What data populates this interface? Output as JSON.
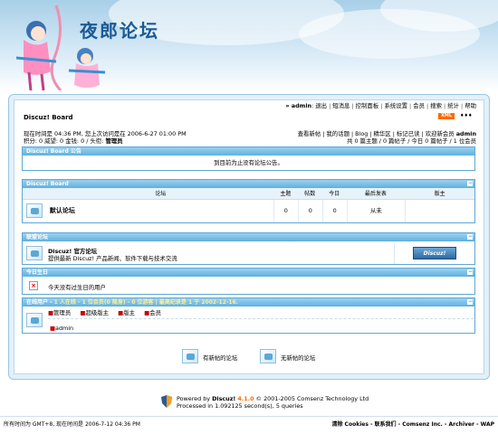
{
  "site": {
    "title": "夜郎论坛"
  },
  "topnav": {
    "user": "admin",
    "items": [
      "退出",
      "短消息",
      "控制面板",
      "系统设置",
      "会员",
      "搜索",
      "统计",
      "帮助"
    ]
  },
  "board": {
    "name": "Discuz! Board",
    "xml": "XML",
    "arrows": "♦♦♦"
  },
  "status": {
    "time_prefix": "现在时间是",
    "time": "04:36 PM",
    "last_visit_prefix": ", 您上次访问是在",
    "last_visit": "2006-6-27 01:00 PM",
    "credits": "积分: 0 威望: 0 金钱: 0 / 头衔:",
    "title": "管理员",
    "links": "查看新帖 | 我的话题 | Blog | 精华区 | 标记已读 | 欢迎新会员",
    "new_member": "admin",
    "stats": "共 0 篇主题 / 0 篇帖子 / 今日 0 篇帖子 / 1 位会员"
  },
  "announce": {
    "header": "Discuz! Board 公告",
    "text": "到目前为止没有论坛公告。"
  },
  "forumbox": {
    "header": "Discuz! Board",
    "columns": [
      "论坛",
      "主题",
      "帖数",
      "今日",
      "最后发表",
      "版主"
    ],
    "rows": [
      {
        "name": "默认论坛",
        "topics": "0",
        "posts": "0",
        "today": "0",
        "last": "从未",
        "mods": ""
      }
    ]
  },
  "links": {
    "header": "联盟论坛",
    "title": "Discuz! 官方论坛",
    "desc": "提供最新 Discuz! 产品新闻、软件下载与技术交流",
    "logo": "Discuz!"
  },
  "birthday": {
    "header": "今日生日",
    "text": "今天没有过生日的用户"
  },
  "online": {
    "header_prefix": "在线用户 - ",
    "header_stats": "1 人在线 - 1 位会员(0 隐身) - 0 位游客 | 最高纪录是 1 于 2002-12-16.",
    "legend": [
      "管理员",
      "超级版主",
      "版主",
      "会员"
    ],
    "users": [
      "admin"
    ]
  },
  "legend_bottom": {
    "new": "有新帖的论坛",
    "nonew": "无新帖的论坛"
  },
  "powered": {
    "prefix": "Powered by ",
    "brand": "Discuz!",
    "version": "4.1.0",
    "copy": "© 2001-2005 Comsenz Technology Ltd",
    "processed": "Processed in 1.092125 second(s), 5 queries"
  },
  "footer": {
    "left": "所有时间为 GMT+8, 现在时间是 2006-7-12 04:36 PM",
    "right": "清除 Cookies - 联系我们 - Comsenz Inc. - Archiver - WAP"
  },
  "colors": {
    "accent": "#5eb1e0",
    "header_blue": "#1a5a94",
    "title_orange": "#ff6a00"
  }
}
